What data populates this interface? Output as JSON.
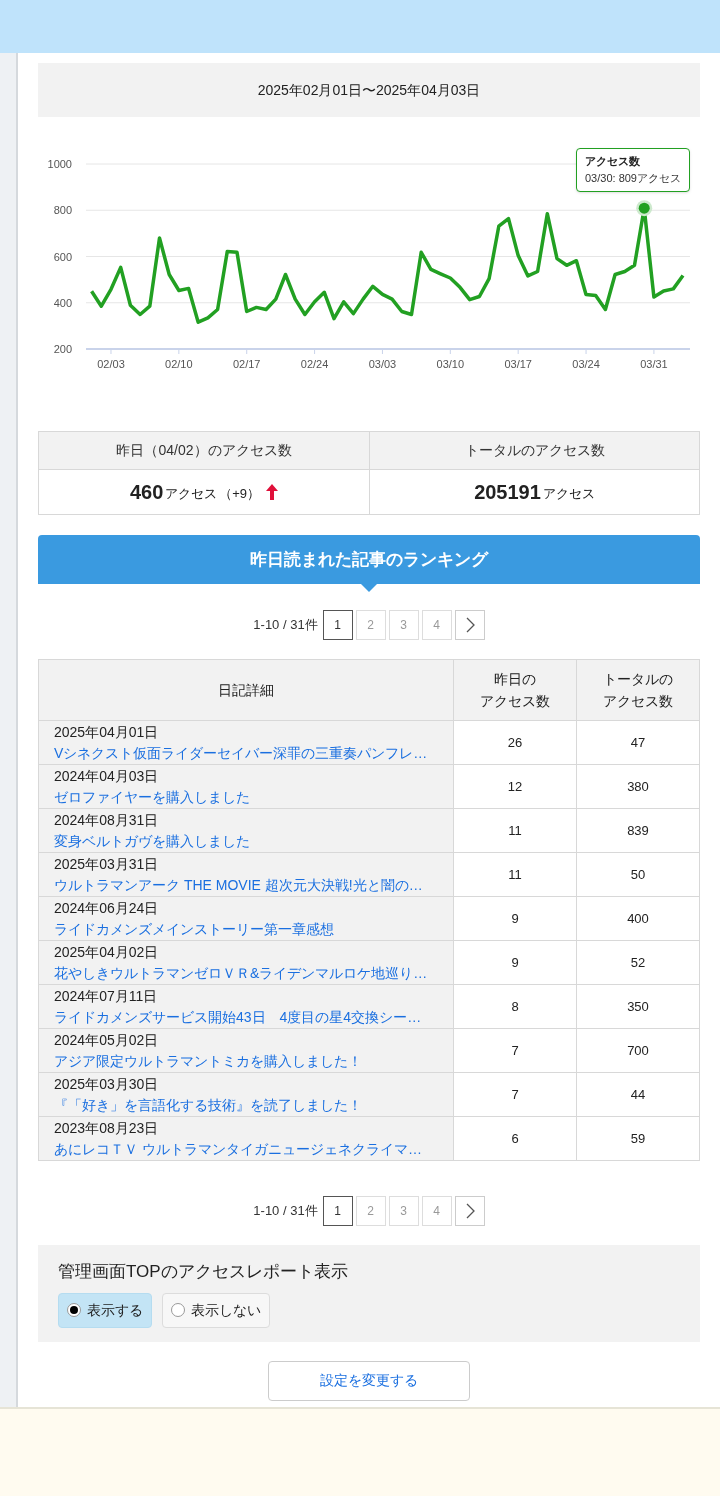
{
  "period": "2025年02月01日〜2025年04月03日",
  "chart": {
    "chart_data": {
      "type": "line",
      "grid": true,
      "categories": [
        null,
        null,
        "02/03",
        null,
        null,
        null,
        null,
        null,
        null,
        "02/10",
        null,
        null,
        null,
        null,
        null,
        null,
        "02/17",
        null,
        null,
        null,
        null,
        null,
        null,
        "02/24",
        null,
        null,
        null,
        null,
        null,
        null,
        "03/03",
        null,
        null,
        null,
        null,
        null,
        null,
        "03/10",
        null,
        null,
        null,
        null,
        null,
        null,
        "03/17",
        null,
        null,
        null,
        null,
        null,
        null,
        "03/24",
        null,
        null,
        null,
        null,
        null,
        null,
        "03/31",
        null,
        null,
        null
      ],
      "series": [
        {
          "name": "アクセス数",
          "color": "#22a022",
          "values": [
            450,
            385,
            458,
            553,
            389,
            349,
            385,
            680,
            522,
            453,
            462,
            316,
            335,
            371,
            622,
            618,
            362,
            380,
            371,
            416,
            522,
            416,
            349,
            404,
            445,
            331,
            404,
            353,
            416,
            471,
            436,
            416,
            362,
            349,
            618,
            544,
            525,
            507,
            467,
            413,
            427,
            504,
            731,
            764,
            604,
            516,
            535,
            785,
            591,
            562,
            582,
            436,
            431,
            371,
            522,
            535,
            562,
            809,
            425,
            451,
            460,
            518
          ]
        }
      ],
      "ylim": [
        200,
        1000
      ],
      "yticks": [
        200,
        400,
        600,
        800,
        1000
      ],
      "annotations": [
        "03/30: 809アクセス"
      ]
    }
  },
  "stats": [
    {
      "header": "昨日（04/02）のアクセス数",
      "value": "460",
      "unit": "アクセス",
      "change": "（+9）",
      "rising": true
    },
    {
      "header": "トータルのアクセス数",
      "value": "205191",
      "unit": "アクセス"
    }
  ],
  "ranking_title": "昨日読まれた記事のランキング",
  "pagination_top": {
    "summary": "1-10 / 31件",
    "pages": [
      {
        "label": "1",
        "selected": true
      },
      {
        "label": "2",
        "selected": false
      },
      {
        "label": "3",
        "selected": false
      },
      {
        "label": "4",
        "selected": false
      }
    ]
  },
  "table": {
    "columns": [
      {
        "lines": [
          "日記詳細"
        ]
      },
      {
        "lines": [
          "昨日の",
          "アクセス数"
        ]
      },
      {
        "lines": [
          "トータルの",
          "アクセス数"
        ]
      }
    ],
    "rows": [
      {
        "date": "2025年04月01日",
        "title": "Vシネクスト仮面ライダーセイバー深罪の三重奏パンフレ…",
        "yesterday": "26",
        "total": "47"
      },
      {
        "date": "2024年04月03日",
        "title": "ゼロファイヤーを購入しました",
        "yesterday": "12",
        "total": "380"
      },
      {
        "date": "2024年08月31日",
        "title": "変身ベルトガヴを購入しました",
        "yesterday": "11",
        "total": "839"
      },
      {
        "date": "2025年03月31日",
        "title": "ウルトラマンアーク THE MOVIE 超次元大決戦!光と闇の…",
        "yesterday": "11",
        "total": "50"
      },
      {
        "date": "2024年06月24日",
        "title": "ライドカメンズメインストーリー第一章感想",
        "yesterday": "9",
        "total": "400"
      },
      {
        "date": "2025年04月02日",
        "title": "花やしきウルトラマンゼロＶＲ&ライデンマルロケ地巡り…",
        "yesterday": "9",
        "total": "52"
      },
      {
        "date": "2024年07月11日",
        "title": "ライドカメンズサービス開始43日　4度目の星4交換シー…",
        "yesterday": "8",
        "total": "350"
      },
      {
        "date": "2024年05月02日",
        "title": "アジア限定ウルトラマントミカを購入しました！",
        "yesterday": "7",
        "total": "700"
      },
      {
        "date": "2025年03月30日",
        "title": "『「好き」を言語化する技術』を読了しました！",
        "yesterday": "7",
        "total": "44"
      },
      {
        "date": "2023年08月23日",
        "title": "あにレコＴＶ ウルトラマンタイガニュージェネクライマ…",
        "yesterday": "6",
        "total": "59"
      }
    ]
  },
  "pagination_bottom": {
    "summary": "1-10 / 31件",
    "pages": [
      {
        "label": "1",
        "selected": true
      },
      {
        "label": "2",
        "selected": false
      },
      {
        "label": "3",
        "selected": false
      },
      {
        "label": "4",
        "selected": false
      }
    ]
  },
  "settings": {
    "title": "管理画面TOPのアクセスレポート表示",
    "options": [
      {
        "label": "表示する",
        "selected": true
      },
      {
        "label": "表示しない",
        "selected": false
      }
    ]
  },
  "submit": "設定を変更する"
}
